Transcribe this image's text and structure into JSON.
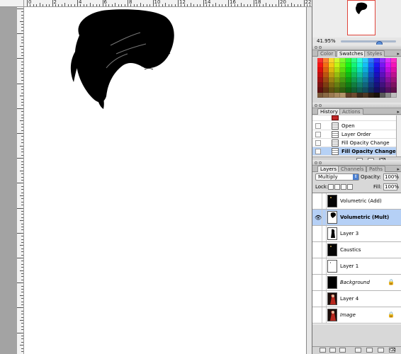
{
  "rulers": {
    "horizontal_labels": [
      "0",
      "2",
      "4",
      "6",
      "8",
      "10",
      "12",
      "14",
      "16",
      "18",
      "20",
      "22"
    ]
  },
  "navigator": {
    "zoom": "41.95%",
    "frame_color": "#e0443a"
  },
  "swatches_palette": {
    "tabs": [
      "Color",
      "Swatches",
      "Styles"
    ],
    "active_tab": "Swatches"
  },
  "history_palette": {
    "tabs": [
      "History",
      "Actions"
    ],
    "active_tab": "History",
    "items": [
      {
        "label": "Open",
        "selected": false
      },
      {
        "label": "Layer Order",
        "selected": false
      },
      {
        "label": "Fill Opacity Change",
        "selected": false
      },
      {
        "label": "Fill Opacity Change",
        "selected": true
      }
    ]
  },
  "layers_palette": {
    "tabs": [
      "Layers",
      "Channels",
      "Paths"
    ],
    "active_tab": "Layers",
    "blend_mode": "Multiply",
    "opacity_label": "Opacity:",
    "opacity_value": "100%",
    "lock_label": "Lock:",
    "fill_label": "Fill:",
    "fill_value": "100%",
    "layers": [
      {
        "name": "Volumetric (Add)",
        "visible": false,
        "selected": false,
        "style": "normal",
        "thumb": "dark",
        "locked": false
      },
      {
        "name": "Volumetric (Mult)",
        "visible": true,
        "selected": true,
        "style": "bold",
        "thumb": "silhouette",
        "locked": false
      },
      {
        "name": "Layer 3",
        "visible": false,
        "selected": false,
        "style": "normal",
        "thumb": "figure",
        "locked": false
      },
      {
        "name": "Caustics",
        "visible": false,
        "selected": false,
        "style": "normal",
        "thumb": "dark",
        "locked": false
      },
      {
        "name": "Layer 1",
        "visible": false,
        "selected": false,
        "style": "normal",
        "thumb": "white",
        "locked": false
      },
      {
        "name": "Background",
        "visible": false,
        "selected": false,
        "style": "italic",
        "thumb": "black",
        "locked": true
      },
      {
        "name": "Layer 4",
        "visible": false,
        "selected": false,
        "style": "normal",
        "thumb": "photo",
        "locked": false
      },
      {
        "name": "Image",
        "visible": false,
        "selected": false,
        "style": "italic",
        "thumb": "photo",
        "locked": true
      }
    ]
  },
  "colors": {
    "selection": "#b5d0f6",
    "accent": "#4b7fd0"
  },
  "icons": {
    "eye": "eye-icon",
    "lock": "lock-icon",
    "palette_menu": "palette-menu-arrow-icon"
  }
}
